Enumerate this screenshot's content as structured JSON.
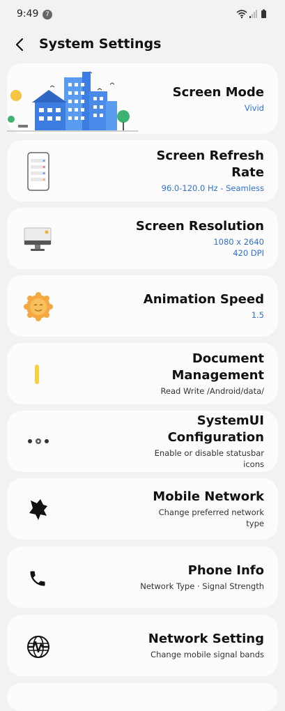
{
  "status_bar": {
    "time": "9:49",
    "notification_count": "7"
  },
  "header": {
    "title": "System Settings"
  },
  "colors": {
    "accent_blue": "#2f6fcf",
    "card_bg": "#fcfcfc",
    "page_bg": "#f2f2f2"
  },
  "settings": [
    {
      "title": "Screen Mode",
      "sub1": "Vivid",
      "sub2": "",
      "icon": "city-illustration-icon",
      "sub_color": "blue"
    },
    {
      "title": "Screen Refresh",
      "title2": "Rate",
      "sub1": "96.0-120.0 Hz - Seamless",
      "sub2": "",
      "icon": "phone-screen-icon",
      "sub_color": "blue"
    },
    {
      "title": "Screen Resolution",
      "sub1": "1080 x 2640",
      "sub2": "420 DPI",
      "icon": "monitor-icon",
      "sub_color": "blue"
    },
    {
      "title": "Animation Speed",
      "sub1": "1.5",
      "sub2": "",
      "icon": "sun-icon",
      "sub_color": "blue"
    },
    {
      "title": "Document",
      "title2": "Management",
      "sub1": "Read Write /Android/data/",
      "sub2": "",
      "icon": "yellow-bar-icon",
      "sub_color": "gray"
    },
    {
      "title": "SystemUI",
      "title2": "Configuration",
      "sub1": "Enable or disable statusbar",
      "sub2": "icons",
      "icon": "dots-icon",
      "sub_color": "gray"
    },
    {
      "title": "Mobile Network",
      "sub1": "Change preferred network",
      "sub2": "type",
      "icon": "network-puzzle-icon",
      "sub_color": "gray"
    },
    {
      "title": "Phone Info",
      "sub1": "Network Type · Signal Strength",
      "sub2": "",
      "icon": "phone-icon",
      "sub_color": "gray"
    },
    {
      "title": "Network Setting",
      "sub1": "Change mobile signal bands",
      "sub2": "",
      "icon": "globe-pulse-icon",
      "sub_color": "gray"
    }
  ]
}
